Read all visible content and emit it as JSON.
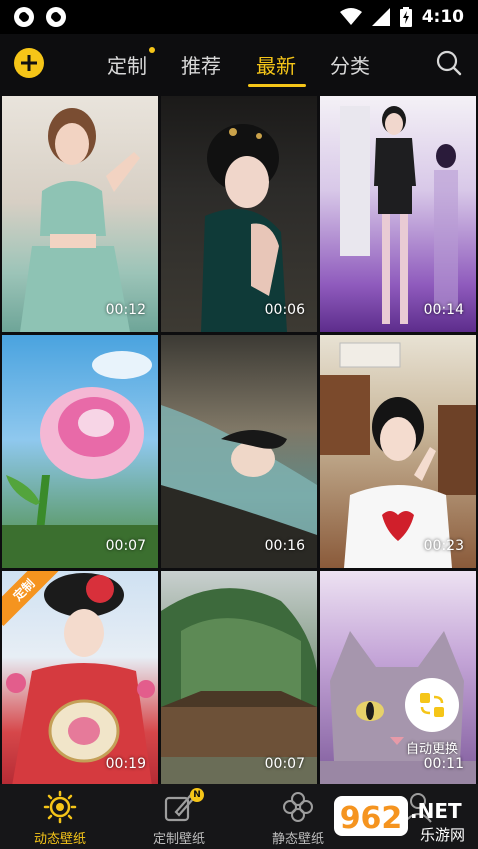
{
  "status": {
    "time": "4:10"
  },
  "tabs": [
    {
      "label": "定制",
      "active": false,
      "dot": true
    },
    {
      "label": "推荐",
      "active": false
    },
    {
      "label": "最新",
      "active": true
    },
    {
      "label": "分类",
      "active": false
    }
  ],
  "grid": {
    "durations": [
      "00:12",
      "00:06",
      "00:14",
      "00:07",
      "00:16",
      "00:23",
      "00:19",
      "00:07",
      "00:11"
    ],
    "badge": "定制"
  },
  "float": {
    "auto_change": "自动更换"
  },
  "bottom_nav": [
    {
      "label": "动态壁纸",
      "active": true
    },
    {
      "label": "定制壁纸",
      "active": false,
      "badge": "N"
    },
    {
      "label": "静态壁纸",
      "active": false
    },
    {
      "label": "",
      "active": false
    }
  ],
  "watermark": {
    "logo": "962",
    "net": ".NET",
    "sub": "乐游网"
  },
  "colors": {
    "accent": "#f5c518",
    "badge_orange": "#f5941f",
    "background": "#0d0d0f"
  }
}
